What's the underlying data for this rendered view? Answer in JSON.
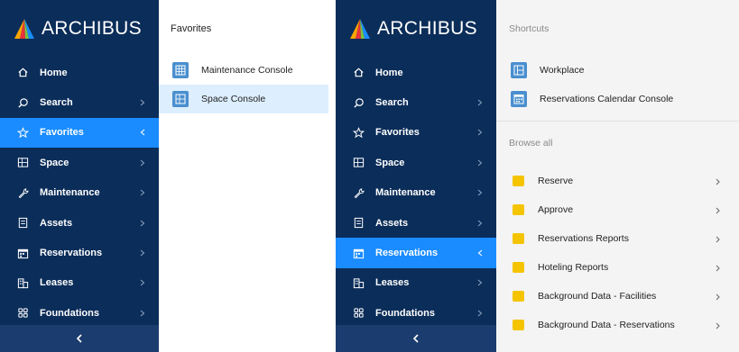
{
  "brand": {
    "name": "ARCHIBUS"
  },
  "left_nav": {
    "items": [
      {
        "label": "Home",
        "icon": "home-icon",
        "has_chevron": false
      },
      {
        "label": "Search",
        "icon": "search-icon",
        "has_chevron": true
      },
      {
        "label": "Favorites",
        "icon": "star-icon",
        "has_chevron": true,
        "active": true,
        "chevron": "left"
      },
      {
        "label": "Space",
        "icon": "floorplan-icon",
        "has_chevron": true
      },
      {
        "label": "Maintenance",
        "icon": "wrench-icon",
        "has_chevron": true
      },
      {
        "label": "Assets",
        "icon": "assets-icon",
        "has_chevron": true
      },
      {
        "label": "Reservations",
        "icon": "calendar-icon",
        "has_chevron": true
      },
      {
        "label": "Leases",
        "icon": "building-icon",
        "has_chevron": true
      },
      {
        "label": "Foundations",
        "icon": "grid-icon",
        "has_chevron": true
      }
    ]
  },
  "favorites_panel": {
    "title": "Favorites",
    "items": [
      {
        "label": "Maintenance Console",
        "icon": "table-icon"
      },
      {
        "label": "Space Console",
        "icon": "floorplan-icon",
        "active": true
      }
    ]
  },
  "right_nav": {
    "items": [
      {
        "label": "Home",
        "icon": "home-icon"
      },
      {
        "label": "Search",
        "icon": "search-icon"
      },
      {
        "label": "Favorites",
        "icon": "star-icon"
      },
      {
        "label": "Space",
        "icon": "floorplan-icon"
      },
      {
        "label": "Maintenance",
        "icon": "wrench-icon"
      },
      {
        "label": "Assets",
        "icon": "assets-icon"
      },
      {
        "label": "Reservations",
        "icon": "calendar-icon",
        "active": true
      },
      {
        "label": "Leases",
        "icon": "building-icon"
      },
      {
        "label": "Foundations",
        "icon": "grid-icon"
      }
    ]
  },
  "shortcuts_panel": {
    "title": "Shortcuts",
    "shortcuts": [
      {
        "label": "Workplace",
        "icon": "layout-icon"
      },
      {
        "label": "Reservations Calendar Console",
        "icon": "calendar-icon"
      }
    ],
    "browse_label": "Browse all",
    "browse_items": [
      {
        "label": "Reserve"
      },
      {
        "label": "Approve"
      },
      {
        "label": "Reservations Reports"
      },
      {
        "label": "Hoteling Reports"
      },
      {
        "label": "Background Data - Facilities"
      },
      {
        "label": "Background Data - Reservations"
      }
    ]
  },
  "colors": {
    "sidebar_bg": "#0b2d59",
    "active_blue": "#1a8cff",
    "collapse_bar": "#1b3c6e",
    "folder_yellow": "#f5c400",
    "tile_blue": "#4a8fcf"
  }
}
